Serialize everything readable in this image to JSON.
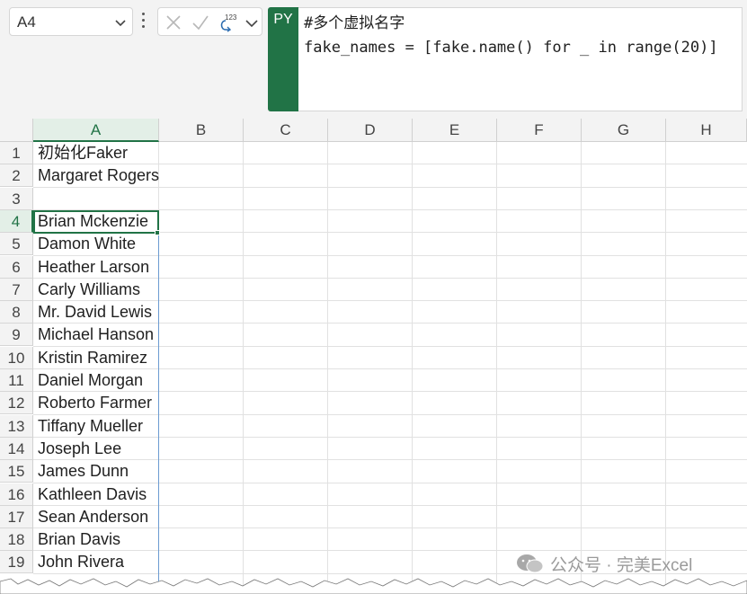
{
  "name_box": {
    "value": "A4"
  },
  "formula_bar": {
    "mode_badge": "PY",
    "lines": [
      "#多个虚拟名字",
      "fake_names = [fake.name() for _ in range(20)]"
    ],
    "tool_icons": [
      "cancel-icon",
      "enter-icon",
      "python-output-icon"
    ],
    "output_superscript": "123"
  },
  "columns": [
    "A",
    "B",
    "C",
    "D",
    "E",
    "F",
    "G",
    "H"
  ],
  "active_column": "A",
  "active_cell": "A4",
  "rows": [
    {
      "num": "1",
      "a": "初始化Faker"
    },
    {
      "num": "2",
      "a": "Margaret Rogers"
    },
    {
      "num": "3",
      "a": ""
    },
    {
      "num": "4",
      "a": "Brian Mckenzie"
    },
    {
      "num": "5",
      "a": "Damon White"
    },
    {
      "num": "6",
      "a": "Heather Larson"
    },
    {
      "num": "7",
      "a": "Carly Williams"
    },
    {
      "num": "8",
      "a": "Mr. David Lewis"
    },
    {
      "num": "9",
      "a": "Michael Hanson"
    },
    {
      "num": "10",
      "a": "Kristin Ramirez"
    },
    {
      "num": "11",
      "a": "Daniel Morgan"
    },
    {
      "num": "12",
      "a": "Roberto Farmer"
    },
    {
      "num": "13",
      "a": "Tiffany Mueller"
    },
    {
      "num": "14",
      "a": "Joseph Lee"
    },
    {
      "num": "15",
      "a": "James Dunn"
    },
    {
      "num": "16",
      "a": "Kathleen Davis"
    },
    {
      "num": "17",
      "a": "Sean Anderson"
    },
    {
      "num": "18",
      "a": "Brian Davis"
    },
    {
      "num": "19",
      "a": "John Rivera"
    }
  ],
  "watermark": {
    "text": "公众号 · 完美Excel"
  },
  "colors": {
    "accent": "#217346",
    "spill_border": "#6b9bd1",
    "header_bg": "#f3f3f3"
  }
}
